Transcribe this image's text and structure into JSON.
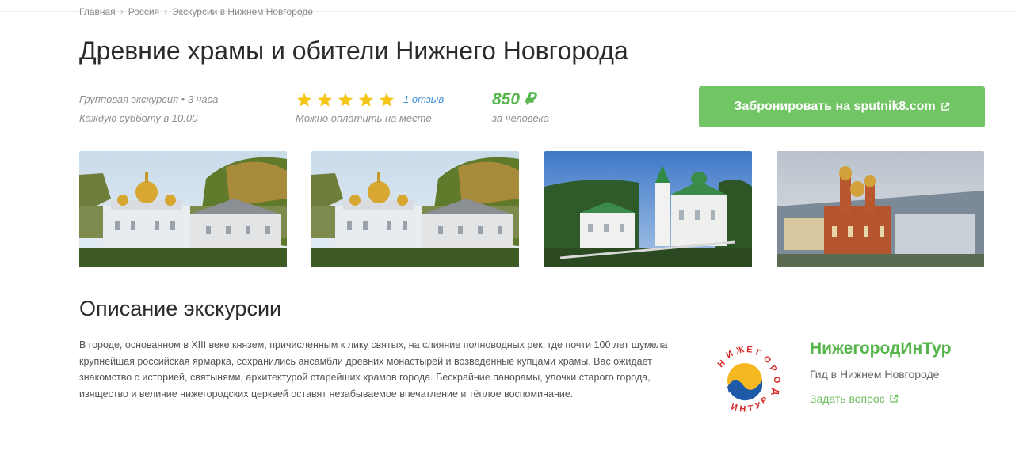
{
  "breadcrumb": [
    "Главная",
    "Россия",
    "Экскурсии в Нижнем Новгороде"
  ],
  "title": "Древние храмы и обители Нижнего Новгорода",
  "tour": {
    "type": "Групповая экскурсия • 3 часа",
    "schedule": "Каждую субботу в 10:00",
    "rating": 5,
    "reviews": "1 отзыв",
    "payment": "Можно оплатить на месте",
    "price": "850 ₽",
    "price_unit": "за человека"
  },
  "book_button": "Забронировать на sputnik8.com",
  "section_title": "Описание экскурсии",
  "description": "В городе, основанном в XIII веке князем, причисленным к лику святых, на слияние полноводных рек, где почти 100 лет шумела крупнейшая российская ярмарка, сохранились ансамбли древних монастырей и возведенные купцами храмы. Вас ожидает знакомство с историей, святынями, архитектурой старейших храмов города. Бескрайние панорамы, улочки старого города, изящество и величие нижегородских церквей оставят незабываемое впечатление и тёплое воспоминание.",
  "organizer": {
    "name": "НижегородИнТур",
    "role": "Гид в Нижнем Новгороде",
    "ask": "Задать вопрос",
    "logo_text": "НИЖЕГОРОД ИНТУР"
  },
  "colors": {
    "accent": "#55b54a",
    "button": "#72c564",
    "star": "#f5c518",
    "link": "#3e8ed6"
  },
  "icons": {
    "external": "external-link-icon",
    "star": "star-icon"
  }
}
